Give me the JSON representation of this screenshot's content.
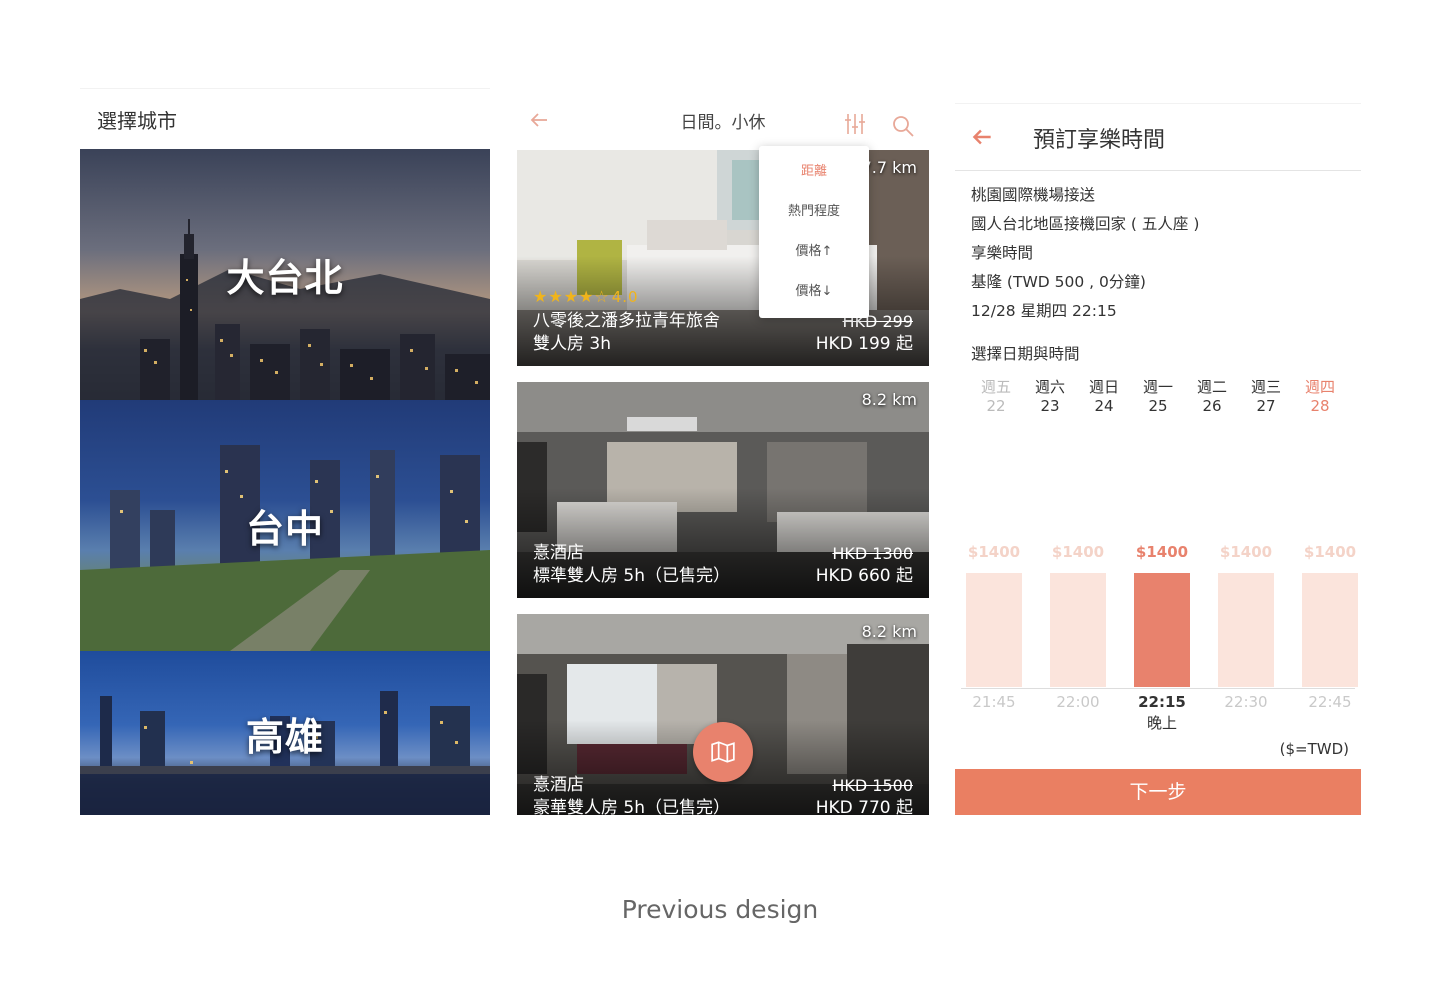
{
  "screen1": {
    "title": "選擇城市",
    "cities": [
      {
        "label": "大台北"
      },
      {
        "label": "台中"
      },
      {
        "label": "高雄"
      }
    ]
  },
  "screen2": {
    "title": "日間。小休",
    "sort_menu": [
      "距離",
      "熱門程度",
      "價格↑",
      "價格↓"
    ],
    "sort_active": "距離",
    "cards": [
      {
        "distance": "7.7 km",
        "stars": "★★★★☆",
        "rating": "4.0",
        "name": "八零後之潘多拉青年旅舍",
        "room": "雙人房 3h",
        "orig_price": "HKD 299",
        "price": "HKD 199 起"
      },
      {
        "distance": "8.2 km",
        "name": "憙酒店",
        "room": "標準雙人房 5h（已售完）",
        "orig_price": "HKD 1300",
        "price": "HKD 660 起"
      },
      {
        "distance": "8.2 km",
        "name": "憙酒店",
        "room": "豪華雙人房 5h（已售完）",
        "orig_price": "HKD 1500",
        "price": "HKD 770 起"
      }
    ]
  },
  "screen3": {
    "title": "預訂享樂時間",
    "info": [
      "桃園國際機場接送",
      "國人台北地區接機回家 ( 五人座 )",
      "享樂時間",
      "基隆 (TWD 500 , 0分鐘)",
      "12/28 星期四 22:15"
    ],
    "section_title": "選擇日期與時間",
    "days": [
      {
        "weekday": "週五",
        "date": "22",
        "state": "disabled"
      },
      {
        "weekday": "週六",
        "date": "23",
        "state": "normal"
      },
      {
        "weekday": "週日",
        "date": "24",
        "state": "normal"
      },
      {
        "weekday": "週一",
        "date": "25",
        "state": "normal"
      },
      {
        "weekday": "週二",
        "date": "26",
        "state": "normal"
      },
      {
        "weekday": "週三",
        "date": "27",
        "state": "normal"
      },
      {
        "weekday": "週四",
        "date": "28",
        "state": "selected"
      }
    ],
    "slots": [
      {
        "price": "$1400",
        "time": "21:45",
        "selected": false
      },
      {
        "price": "$1400",
        "time": "22:00",
        "selected": false
      },
      {
        "price": "$1400",
        "time": "22:15",
        "selected": true,
        "period": "晚上"
      },
      {
        "price": "$1400",
        "time": "22:30",
        "selected": false
      },
      {
        "price": "$1400",
        "time": "22:45",
        "selected": false
      }
    ],
    "currency_note": "($=TWD)",
    "next_label": "下一步"
  },
  "caption": "Previous design",
  "colors": {
    "accent": "#e8826d",
    "bar_light": "#fbe4dc",
    "star": "#f0b41c"
  }
}
